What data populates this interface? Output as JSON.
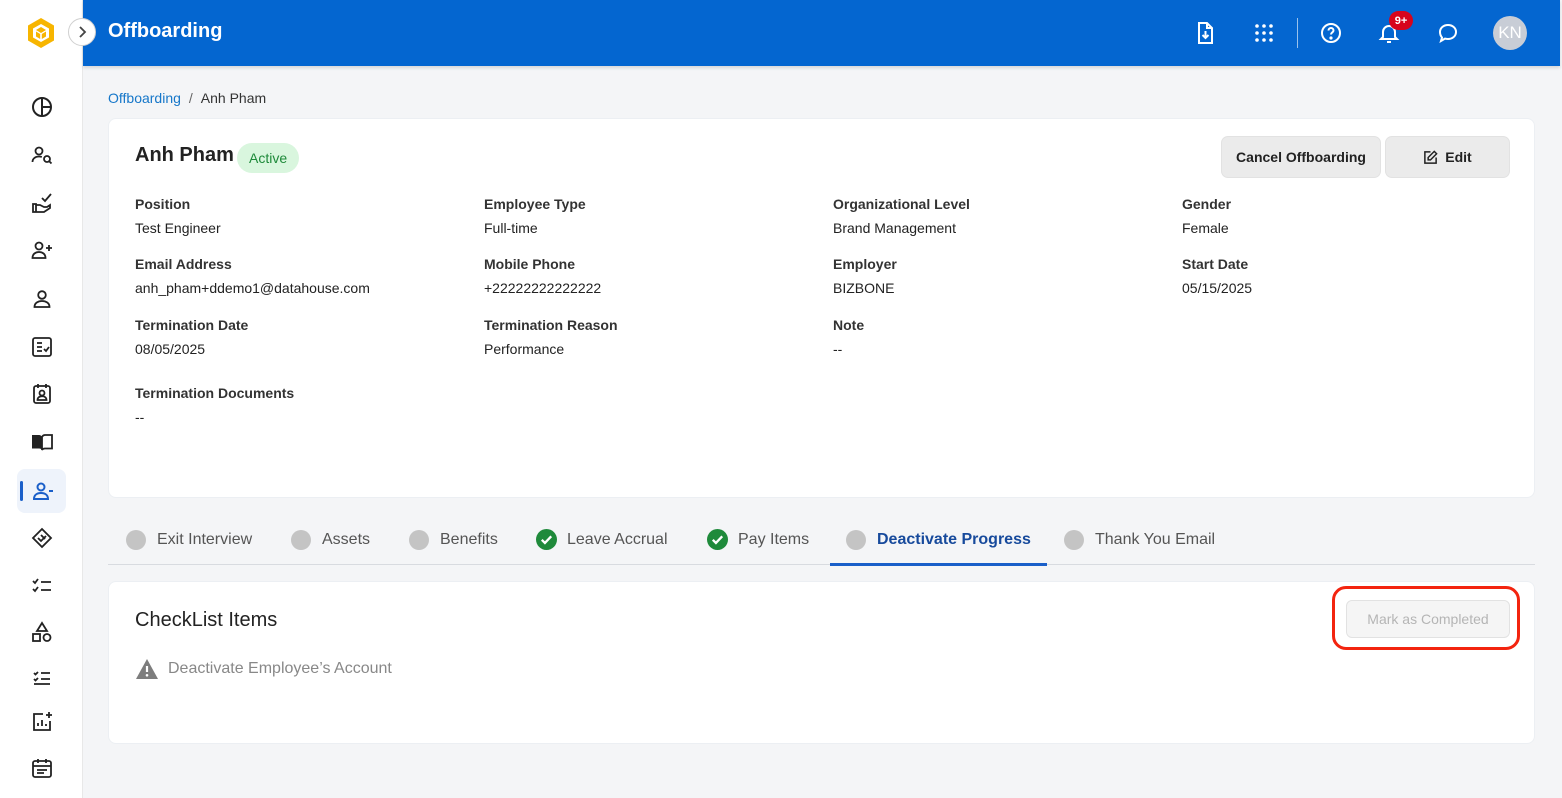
{
  "header": {
    "title": "Offboarding",
    "notification_count": "9+",
    "avatar_initials": "KN",
    "icons": [
      "document-download-icon",
      "apps-grid-icon",
      "help-icon",
      "bell-icon",
      "chat-icon"
    ]
  },
  "sidebar": {
    "items": [
      {
        "name": "dashboard-pie-icon"
      },
      {
        "name": "user-search-icon"
      },
      {
        "name": "hand-check-icon"
      },
      {
        "name": "user-plus-icon"
      },
      {
        "name": "user-icon"
      },
      {
        "name": "checklist-doc-icon"
      },
      {
        "name": "contact-card-icon"
      },
      {
        "name": "book-icon"
      },
      {
        "name": "user-minus-icon",
        "active": true
      },
      {
        "name": "handshake-icon"
      },
      {
        "name": "checklist-icon"
      },
      {
        "name": "shapes-icon"
      },
      {
        "name": "task-list-icon"
      },
      {
        "name": "report-add-icon"
      },
      {
        "name": "calendar-icon"
      }
    ]
  },
  "breadcrumb": {
    "parent": "Offboarding",
    "separator": "/",
    "current": "Anh Pham"
  },
  "employee": {
    "name": "Anh Pham",
    "status": "Active",
    "cancel_label": "Cancel Offboarding",
    "edit_label": "Edit",
    "fields": {
      "position": {
        "label": "Position",
        "value": "Test Engineer"
      },
      "employee_type": {
        "label": "Employee Type",
        "value": "Full-time"
      },
      "org_level": {
        "label": "Organizational Level",
        "value": "Brand Management"
      },
      "gender": {
        "label": "Gender",
        "value": "Female"
      },
      "email": {
        "label": "Email Address",
        "value": "anh_pham+ddemo1@datahouse.com"
      },
      "mobile": {
        "label": "Mobile Phone",
        "value": "+22222222222222"
      },
      "employer": {
        "label": "Employer",
        "value": "BIZBONE"
      },
      "start_date": {
        "label": "Start Date",
        "value": "05/15/2025"
      },
      "termination_date": {
        "label": "Termination Date",
        "value": "08/05/2025"
      },
      "termination_reason": {
        "label": "Termination Reason",
        "value": "Performance"
      },
      "note": {
        "label": "Note",
        "value": "--"
      },
      "termination_docs": {
        "label": "Termination Documents",
        "value": "--"
      }
    }
  },
  "tabs": {
    "exit_interview": {
      "label": "Exit Interview",
      "state": "pending"
    },
    "assets": {
      "label": "Assets",
      "state": "pending"
    },
    "benefits": {
      "label": "Benefits",
      "state": "pending"
    },
    "leave_accrual": {
      "label": "Leave Accrual",
      "state": "done"
    },
    "pay_items": {
      "label": "Pay Items",
      "state": "done"
    },
    "deactivate_progress": {
      "label": "Deactivate Progress",
      "state": "pending",
      "active": true
    },
    "thank_you_email": {
      "label": "Thank You Email",
      "state": "pending"
    }
  },
  "checklist": {
    "title": "CheckList Items",
    "mark_completed_label": "Mark as Completed",
    "items": [
      {
        "label": "Deactivate Employee’s Account",
        "icon": "warning-icon"
      }
    ]
  },
  "colors": {
    "header_bg": "#0466d0",
    "accent": "#1a5fc9",
    "active_tab_text": "#174a9c",
    "status_bg": "#d9f6de",
    "status_text": "#1e8a3a",
    "done_check": "#1f8a3b",
    "highlight": "#f3240f",
    "badge_bg": "#d7041c"
  }
}
